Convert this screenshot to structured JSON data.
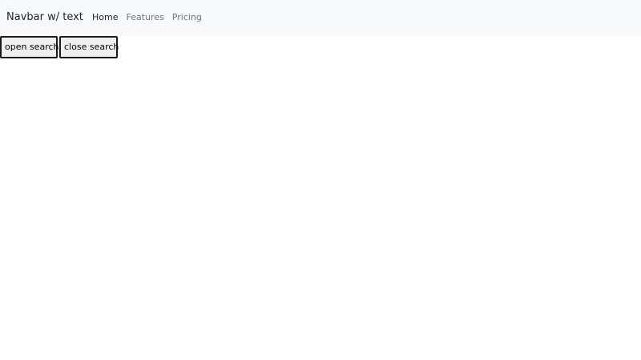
{
  "navbar": {
    "brand": "Navbar w/ text",
    "links": [
      {
        "label": "Home",
        "active": true
      },
      {
        "label": "Features",
        "active": false
      },
      {
        "label": "Pricing",
        "active": false
      }
    ]
  },
  "buttons": {
    "open_label": "open search",
    "close_label": "close search"
  },
  "colors": {
    "navbar_bg": "#f8f9fa",
    "active_link": "#212529",
    "inactive_link": "#6c757d"
  }
}
